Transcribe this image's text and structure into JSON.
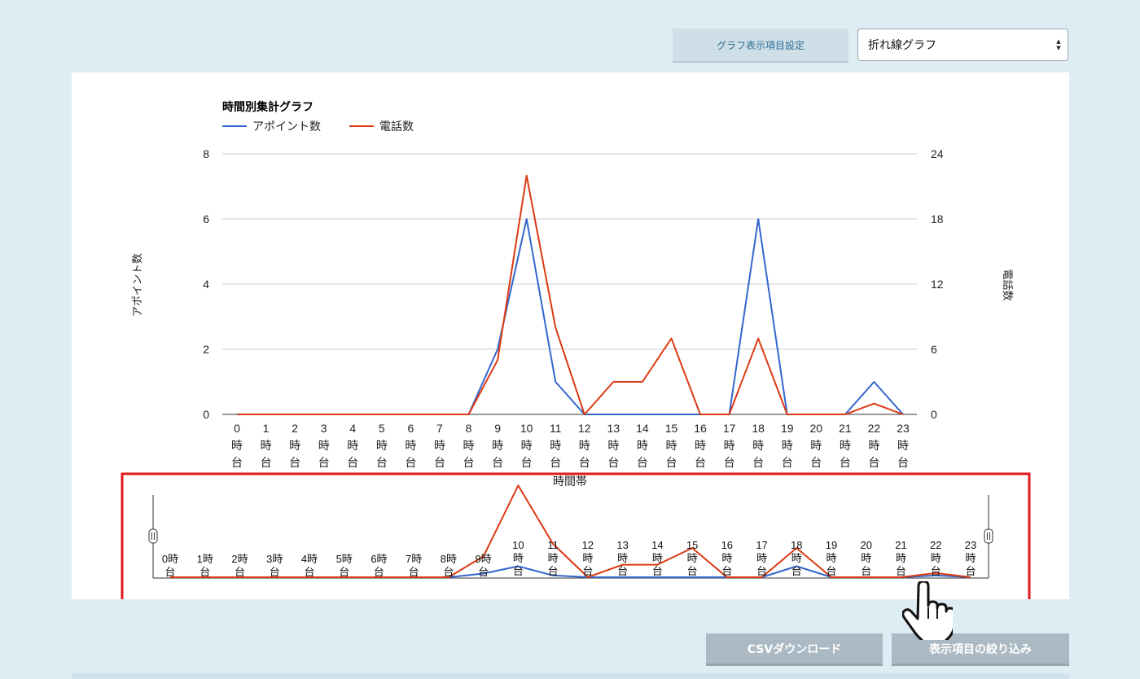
{
  "toolbar": {
    "graph_settings_label": "グラフ表示項目設定",
    "graph_type_value": "折れ線グラフ"
  },
  "buttons": {
    "csv_label": "CSVダウンロード",
    "filter_label": "表示項目の絞り込み"
  },
  "colors": {
    "series_appointments": "#3366cc",
    "series_calls": "#dc3912",
    "highlight_box": "#e0191e"
  },
  "chart_data": {
    "type": "line",
    "title": "時間別集計グラフ",
    "xlabel": "時間帯",
    "ylabel_left": "アポイント数",
    "ylabel_right": "電話数",
    "legend_position": "top-left",
    "grid": true,
    "categories": [
      "0時台",
      "1時台",
      "2時台",
      "3時台",
      "4時台",
      "5時台",
      "6時台",
      "7時台",
      "8時台",
      "9時台",
      "10時台",
      "11時台",
      "12時台",
      "13時台",
      "14時台",
      "15時台",
      "16時台",
      "17時台",
      "18時台",
      "19時台",
      "20時台",
      "21時台",
      "22時台",
      "23時台"
    ],
    "y_left": {
      "min": 0,
      "max": 8,
      "ticks": [
        "0",
        "2",
        "4",
        "6",
        "8"
      ]
    },
    "y_right": {
      "min": 0,
      "max": 24,
      "ticks": [
        "0",
        "6",
        "12",
        "18",
        "24"
      ]
    },
    "series": [
      {
        "name": "アポイント数",
        "axis": "left",
        "values": [
          0,
          0,
          0,
          0,
          0,
          0,
          0,
          0,
          0,
          2,
          6,
          1,
          0,
          0,
          0,
          0,
          0,
          0,
          6,
          0,
          0,
          0,
          1,
          0
        ]
      },
      {
        "name": "電話数",
        "axis": "right",
        "values": [
          0,
          0,
          0,
          0,
          0,
          0,
          0,
          0,
          0,
          5,
          22,
          8,
          0,
          3,
          3,
          7,
          0,
          0,
          7,
          0,
          0,
          0,
          1,
          0
        ]
      }
    ]
  }
}
